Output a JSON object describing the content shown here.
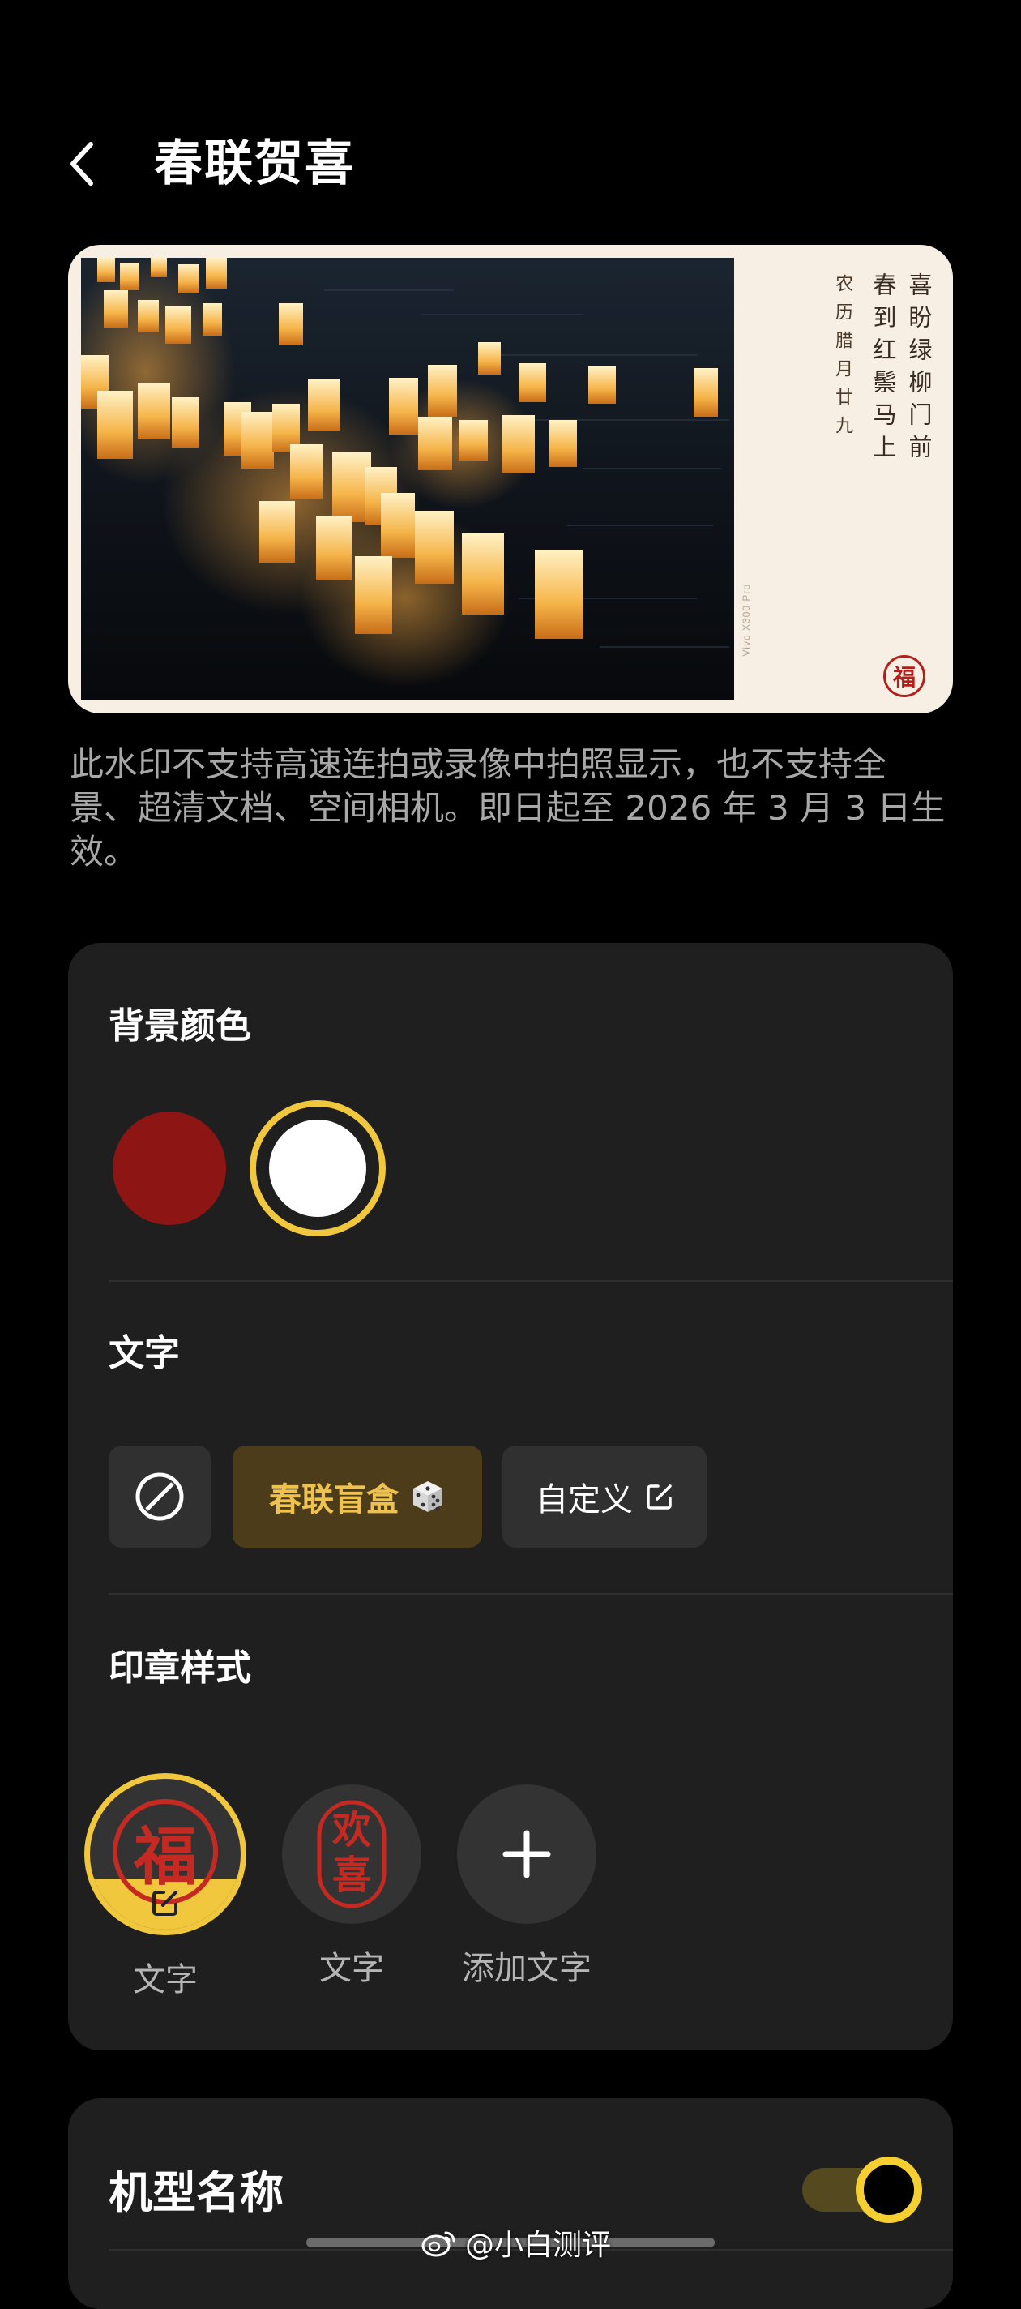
{
  "header": {
    "title": "春联贺喜"
  },
  "preview": {
    "couplet_right": "喜盼绿柳门前",
    "couplet_left": "春到红鬃马上",
    "lunar_date": "农历腊月廿九",
    "brand_text": "Vivo X300 Pro",
    "seal_char": "福"
  },
  "notice": "此水印不支持高速连拍或录像中拍照显示，也不支持全景、超清文档、空间相机。即日起至 2026 年 3 月 3 日生效。",
  "settings": {
    "bg_color": {
      "title": "背景颜色",
      "options": [
        {
          "color": "#8d1615",
          "selected": false
        },
        {
          "color": "#ffffff",
          "selected": true
        }
      ]
    },
    "text": {
      "title": "文字",
      "blind_box_label": "春联盲盒",
      "custom_label": "自定义"
    },
    "seal_style": {
      "title": "印章样式",
      "options": [
        {
          "label": "文字",
          "glyph": "福",
          "selected": true
        },
        {
          "label": "文字",
          "glyph_top": "欢",
          "glyph_bottom": "喜",
          "selected": false
        },
        {
          "label": "添加文字"
        }
      ]
    }
  },
  "model_name": {
    "label": "机型名称",
    "enabled": true
  },
  "watermark": {
    "text": "@小白测评"
  },
  "colors": {
    "accent": "#f1c83d",
    "seal_red": "#b3201c",
    "panel_bg": "#1f1f1f"
  }
}
